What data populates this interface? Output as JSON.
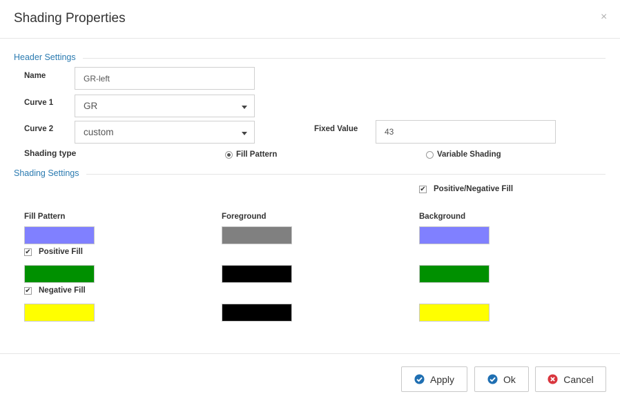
{
  "dialog": {
    "title": "Shading Properties",
    "close_symbol": "×"
  },
  "header_settings": {
    "legend": "Header Settings",
    "name_label": "Name",
    "name_value": "GR-left",
    "curve1_label": "Curve 1",
    "curve1_value": "GR",
    "curve2_label": "Curve 2",
    "curve2_value": "custom",
    "fixed_value_label": "Fixed Value",
    "fixed_value": "43",
    "shading_type_label": "Shading type",
    "shading_options": [
      {
        "label": "Fill Pattern",
        "selected": true
      },
      {
        "label": "Variable Shading",
        "selected": false
      }
    ]
  },
  "shading_settings": {
    "legend": "Shading Settings",
    "pos_neg_fill_label": "Positive/Negative Fill",
    "pos_neg_fill_checked": true,
    "columns": [
      "Fill Pattern",
      "Foreground",
      "Background"
    ],
    "rows": [
      {
        "label": "",
        "fill_pattern": "#8080ff",
        "foreground": "#808080",
        "background": "#8080ff"
      },
      {
        "label": "Positive Fill",
        "checked": true,
        "fill_pattern": "#009000",
        "foreground": "#000000",
        "background": "#009000"
      },
      {
        "label": "Negative Fill",
        "checked": true,
        "fill_pattern": "#ffff00",
        "foreground": "#000000",
        "background": "#ffff00"
      }
    ]
  },
  "footer": {
    "apply_label": "Apply",
    "ok_label": "Ok",
    "cancel_label": "Cancel",
    "apply_icon": "check-circle-icon",
    "ok_icon": "check-circle-icon",
    "cancel_icon": "x-circle-icon",
    "accent_color": "#1f6fb2",
    "cancel_color": "#d9363e"
  }
}
